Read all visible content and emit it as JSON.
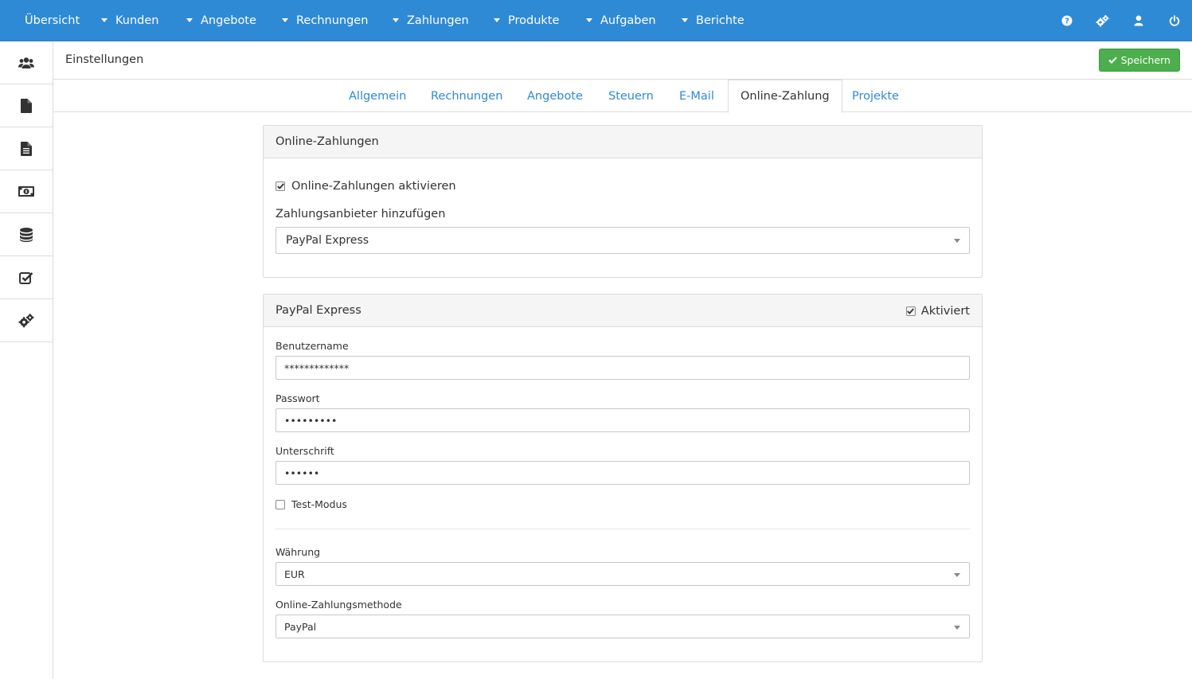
{
  "nav": {
    "items": [
      {
        "label": "Übersicht",
        "dropdown": false
      },
      {
        "label": "Kunden",
        "dropdown": true
      },
      {
        "label": "Angebote",
        "dropdown": true
      },
      {
        "label": "Rechnungen",
        "dropdown": true
      },
      {
        "label": "Zahlungen",
        "dropdown": true
      },
      {
        "label": "Produkte",
        "dropdown": true
      },
      {
        "label": "Aufgaben",
        "dropdown": true
      },
      {
        "label": "Berichte",
        "dropdown": true
      }
    ],
    "right_icons": [
      "help-icon",
      "settings-icon",
      "user-icon",
      "power-icon"
    ]
  },
  "sidebar": {
    "items": [
      "clients-icon",
      "quote-file-icon",
      "invoice-file-icon",
      "money-icon",
      "database-icon",
      "tasks-icon",
      "settings-icon"
    ]
  },
  "header": {
    "title": "Einstellungen",
    "save_label": "Speichern"
  },
  "tabs": {
    "items": [
      "Allgemein",
      "Rechnungen",
      "Angebote",
      "Steuern",
      "E-Mail",
      "Online-Zahlung",
      "Projekte"
    ],
    "active": "Online-Zahlung"
  },
  "online_payments": {
    "title": "Online-Zahlungen",
    "enable_label": "Online-Zahlungen aktivieren",
    "enable_checked": true,
    "provider_label": "Zahlungsanbieter hinzufügen",
    "provider_value": "PayPal Express"
  },
  "paypal": {
    "title": "PayPal Express",
    "active_label": "Aktiviert",
    "active_checked": true,
    "username_label": "Benutzername",
    "username_value": "*************",
    "password_label": "Passwort",
    "password_value": "•••••••••",
    "signature_label": "Unterschrift",
    "signature_value": "••••••",
    "testmode_label": "Test-Modus",
    "testmode_checked": false,
    "currency_label": "Währung",
    "currency_value": "EUR",
    "method_label": "Online-Zahlungsmethode",
    "method_value": "PayPal"
  },
  "colors": {
    "primary": "#2f8ad6",
    "success": "#4cae4c"
  }
}
